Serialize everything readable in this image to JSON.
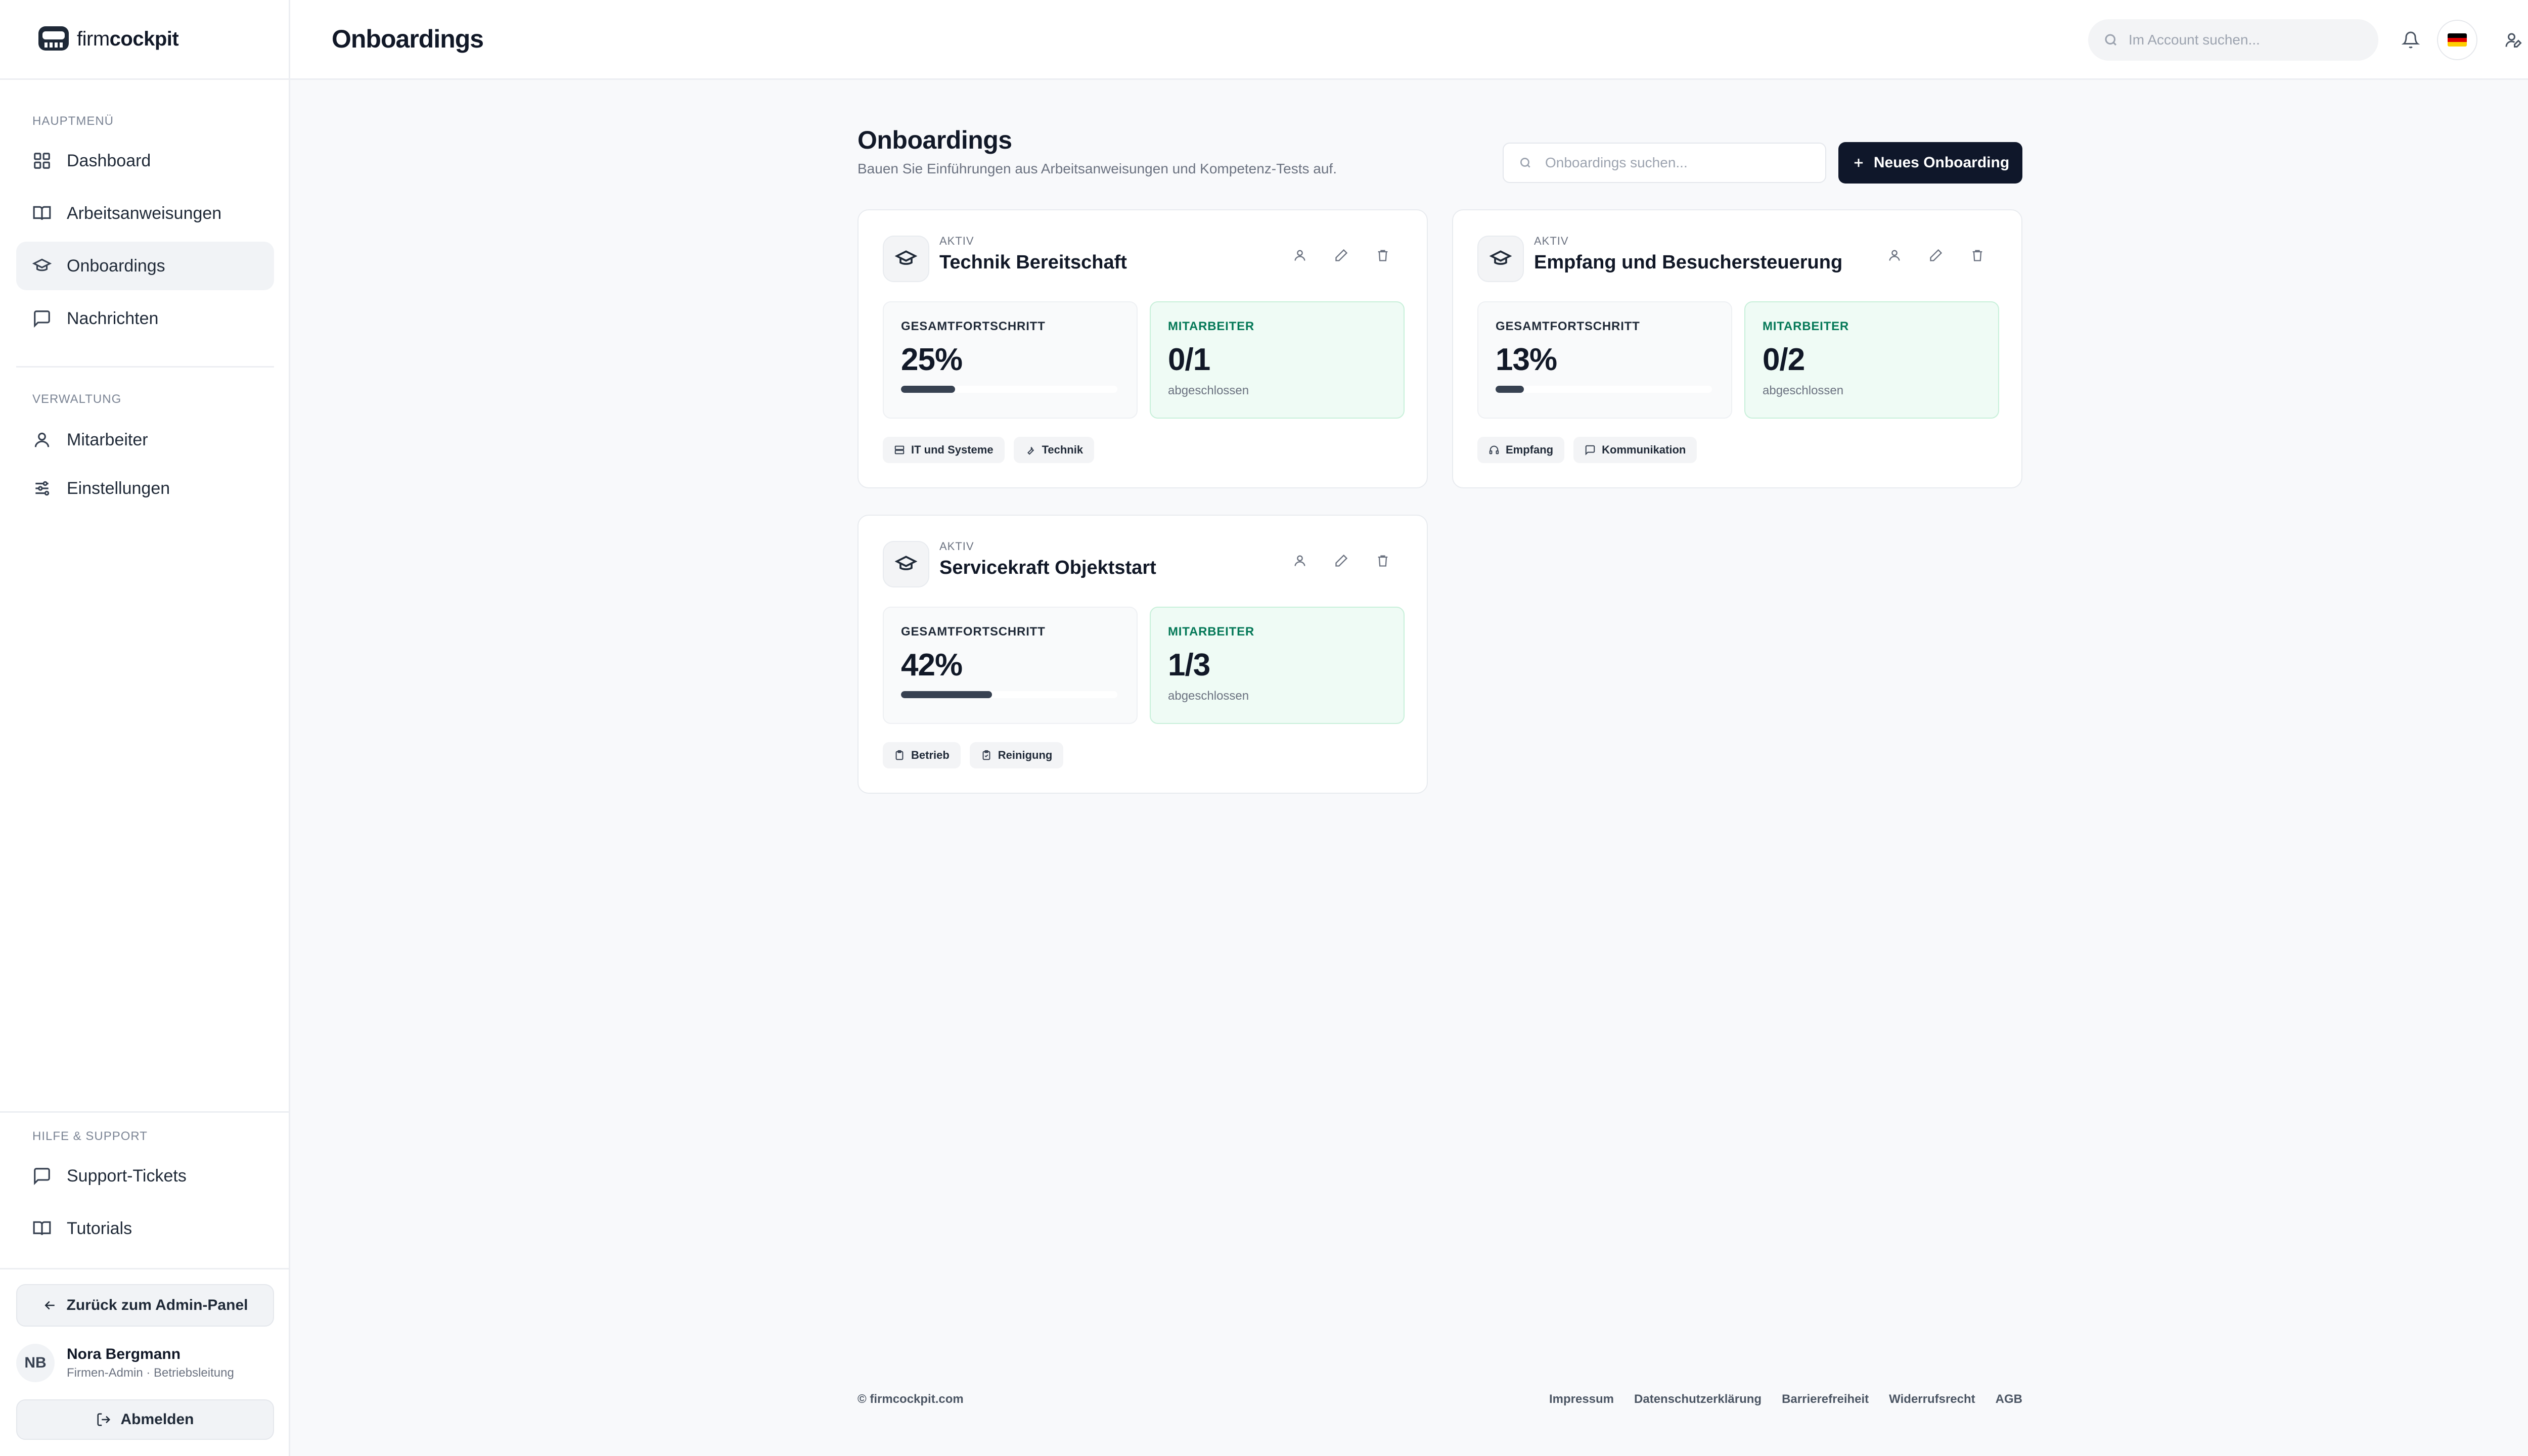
{
  "brand": {
    "name_light": "firm",
    "name_bold": "cockpit"
  },
  "sidebar": {
    "main_label": "HAUPTMENÜ",
    "main_items": [
      {
        "label": "Dashboard",
        "icon": "grid-icon",
        "active": false
      },
      {
        "label": "Arbeitsanweisungen",
        "icon": "book-icon",
        "active": false
      },
      {
        "label": "Onboardings",
        "icon": "graduation-cap-icon",
        "active": true
      },
      {
        "label": "Nachrichten",
        "icon": "message-icon",
        "active": false
      }
    ],
    "admin_label": "VERWALTUNG",
    "admin_items": [
      {
        "label": "Mitarbeiter",
        "icon": "user-icon"
      },
      {
        "label": "Einstellungen",
        "icon": "sliders-icon"
      }
    ],
    "help_label": "HILFE & SUPPORT",
    "help_items": [
      {
        "label": "Support-Tickets",
        "icon": "message-icon"
      },
      {
        "label": "Tutorials",
        "icon": "book-icon"
      }
    ],
    "back_button": "Zurück zum Admin-Panel",
    "user": {
      "initials": "NB",
      "name": "Nora Bergmann",
      "role": "Firmen-Admin · Betriebsleitung"
    },
    "logout_button": "Abmelden"
  },
  "topbar": {
    "title": "Onboardings",
    "search_placeholder": "Im Account suchen...",
    "language": "de",
    "colors": {
      "flag_black": "#000000",
      "flag_red": "#dd0000",
      "flag_gold": "#ffce00"
    }
  },
  "content": {
    "title": "Onboardings",
    "subtitle": "Bauen Sie Einführungen aus Arbeitsanweisungen und Kompetenz-Tests auf.",
    "search_placeholder": "Onboardings suchen...",
    "new_button": "Neues Onboarding"
  },
  "cards": [
    {
      "status": "AKTIV",
      "title": "Technik Bereitschaft",
      "progress_label": "GESAMTFORTSCHRITT",
      "progress_value": "25%",
      "progress_fraction": 0.25,
      "workers_label": "MITARBEITER",
      "workers_value": "0/1",
      "workers_sub": "abgeschlossen",
      "tags": [
        {
          "label": "IT und Systeme",
          "icon": "server-icon"
        },
        {
          "label": "Technik",
          "icon": "wrench-icon"
        }
      ]
    },
    {
      "status": "AKTIV",
      "title": "Empfang und Besuchersteuerung",
      "progress_label": "GESAMTFORTSCHRITT",
      "progress_value": "13%",
      "progress_fraction": 0.13,
      "workers_label": "MITARBEITER",
      "workers_value": "0/2",
      "workers_sub": "abgeschlossen",
      "tags": [
        {
          "label": "Empfang",
          "icon": "headset-icon"
        },
        {
          "label": "Kommunikation",
          "icon": "message-icon"
        }
      ]
    },
    {
      "status": "AKTIV",
      "title": "Servicekraft Objektstart",
      "progress_label": "GESAMTFORTSCHRITT",
      "progress_value": "42%",
      "progress_fraction": 0.42,
      "workers_label": "MITARBEITER",
      "workers_value": "1/3",
      "workers_sub": "abgeschlossen",
      "tags": [
        {
          "label": "Betrieb",
          "icon": "clipboard-icon"
        },
        {
          "label": "Reinigung",
          "icon": "clipboard-check-icon"
        }
      ]
    }
  ],
  "footer": {
    "copyright": "© firmcockpit.com",
    "links": [
      "Impressum",
      "Datenschutzerklärung",
      "Barrierefreiheit",
      "Widerrufsrecht",
      "AGB"
    ]
  },
  "colors": {
    "accent": "#0f172a",
    "success_bg": "#effbf5",
    "success_text": "#047857",
    "progress_bar": "#374151"
  }
}
